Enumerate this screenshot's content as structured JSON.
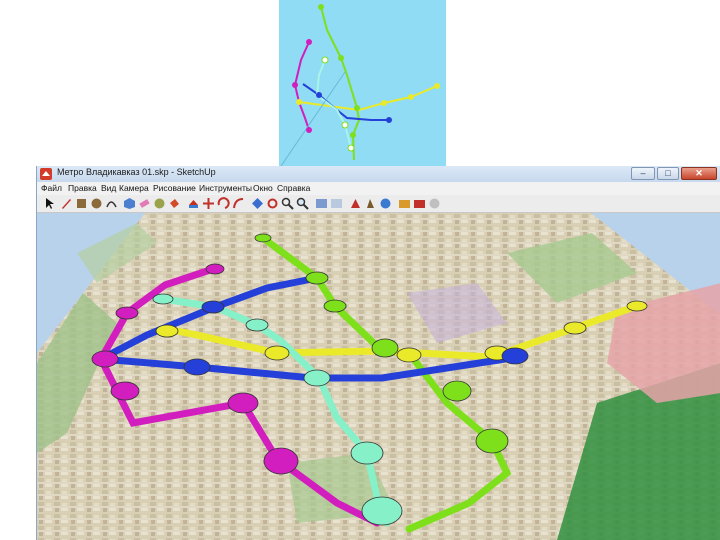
{
  "window": {
    "title": "Метро Владикавказ 01.skp - SketchUp",
    "controls": {
      "minimize": "–",
      "maximize": "□",
      "close": "✕"
    }
  },
  "menu": [
    "Файл",
    "Правка",
    "Вид",
    "Камера",
    "Рисование",
    "Инструменты",
    "Окно",
    "Справка"
  ],
  "toolbar": {
    "tools": [
      "select-icon",
      "pencil-icon",
      "rectangle-icon",
      "circle-icon",
      "arc-icon",
      "make-component-icon",
      "eraser-icon",
      "tape-measure-icon",
      "paint-bucket-icon",
      "push-pull-icon",
      "move-icon",
      "rotate-icon",
      "follow-me-icon",
      "offset-icon",
      "orbit-icon",
      "pan-icon",
      "zoom-icon",
      "zoom-extents-icon",
      "previous-view-icon",
      "next-view-icon",
      "standard-views-icon",
      "section-plane-icon",
      "xray-icon",
      "shaded-icon",
      "google-earth-icon",
      "warehouse-icon",
      "share-model-icon",
      "extension-icon",
      "settings-icon"
    ]
  },
  "colors": {
    "green_line": "#7de01a",
    "yellow_line": "#eaea2a",
    "blue_line": "#2440d8",
    "magenta_line": "#d21ebe",
    "cyan_line": "#86f0c8",
    "sky": "#8fdcf4",
    "map_base": "#d9cfb4"
  }
}
